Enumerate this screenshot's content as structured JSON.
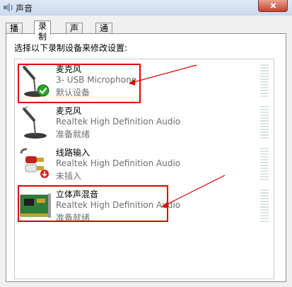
{
  "window": {
    "title": "声音"
  },
  "tabs": [
    {
      "label": "播放"
    },
    {
      "label": "录制"
    },
    {
      "label": "声音"
    },
    {
      "label": "通信"
    }
  ],
  "instruction": "选择以下录制设备来修改设置:",
  "devices": [
    {
      "name": "麦克风",
      "description": "3- USB Microphone",
      "status": "默认设备",
      "icon": "microphone-icon",
      "badge": "default-check-icon"
    },
    {
      "name": "麦克风",
      "description": "Realtek High Definition Audio",
      "status": "准备就绪",
      "icon": "microphone-icon"
    },
    {
      "name": "线路输入",
      "description": "Realtek High Definition Audio",
      "status": "未插入",
      "icon": "line-in-jack-icon",
      "badge": "unplugged-arrow-icon"
    },
    {
      "name": "立体声混音",
      "description": "Realtek High Definition Audio",
      "status": "准备就绪",
      "icon": "sound-card-icon"
    }
  ],
  "colors": {
    "highlight": "#e10000",
    "selected_row": "#ffffff",
    "status_text": "#6d6d6d"
  }
}
